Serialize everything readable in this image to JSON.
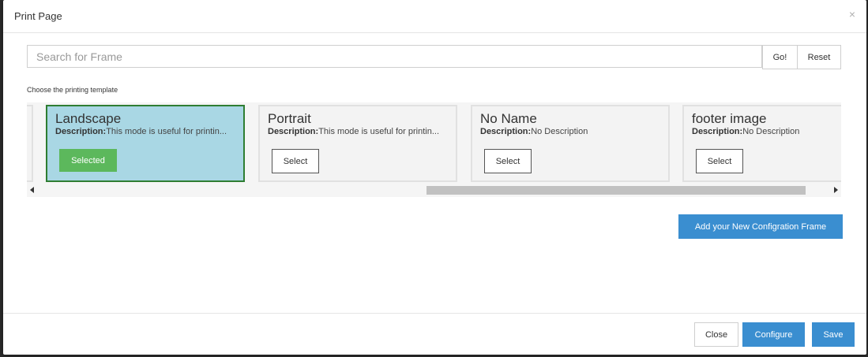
{
  "dialog": {
    "title": "Print Page",
    "close_glyph": "×"
  },
  "search": {
    "placeholder": "Search for Frame",
    "value": "",
    "go_label": "Go!",
    "reset_label": "Reset"
  },
  "template_section": {
    "label": "Choose the printing template",
    "description_prefix": "Description:",
    "cards": [
      {
        "title": "Landscape",
        "description": "This mode is useful for printin...",
        "button_label": "Selected",
        "selected": true
      },
      {
        "title": "Portrait",
        "description": "This mode is useful for printin...",
        "button_label": "Select",
        "selected": false
      },
      {
        "title": "No Name",
        "description": "No Description",
        "button_label": "Select",
        "selected": false
      },
      {
        "title": "footer image",
        "description": "No Description",
        "button_label": "Select",
        "selected": false
      }
    ]
  },
  "add_frame_label": "Add your New Configration Frame",
  "footer": {
    "close_label": "Close",
    "configure_label": "Configure",
    "save_label": "Save"
  },
  "colors": {
    "primary": "#3a8ed0",
    "selected_card_bg": "#a9d7e4",
    "selected_card_border": "#2e7d32",
    "selected_button": "#5cb85c"
  },
  "icons": {
    "close": "close-icon",
    "scroll_left": "arrow-left-icon",
    "scroll_right": "arrow-right-icon"
  }
}
